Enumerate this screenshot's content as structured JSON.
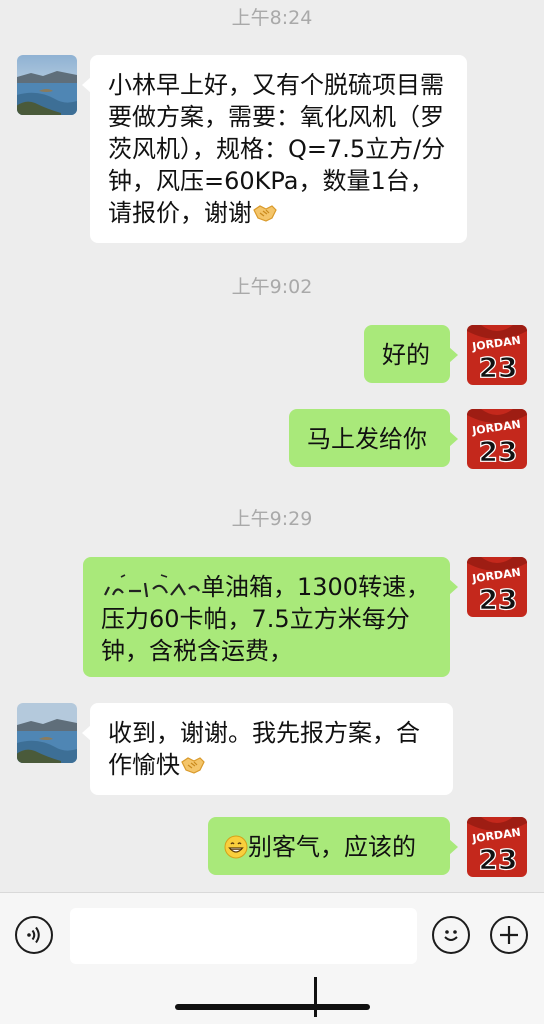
{
  "messages": {
    "time1": "上午8:24",
    "m1": "小林早上好，又有个脱硫项目需要做方案，需要：氧化风机（罗茨风机），规格：Q=7.5立方/分钟，风压=60KPa，数量1台，请报价，谢谢",
    "time2": "上午9:02",
    "m2": "好的",
    "m3": "马上发给你",
    "time3": "上午9:29",
    "m4_visible": "单油箱，1300转速，压力60卡帕，7.5立方米每分钟，含税含运费，",
    "m5": "收到，谢谢。我先报方案，合作愉快",
    "m6": "别客气，应该的"
  },
  "avatars": {
    "contact": "lake-landscape-avatar",
    "self_text_top": "JORDAN",
    "self_text_number": "23",
    "self_color": "#c4281c"
  },
  "icons": {
    "handshake": "handshake-emoji",
    "grin": "grinning-emoji",
    "voice": "voice-icon",
    "smiley": "smiley-icon",
    "add": "plus-icon"
  },
  "colors": {
    "background": "#ededed",
    "bubble_self": "#a9e97a",
    "bubble_other": "#ffffff"
  }
}
